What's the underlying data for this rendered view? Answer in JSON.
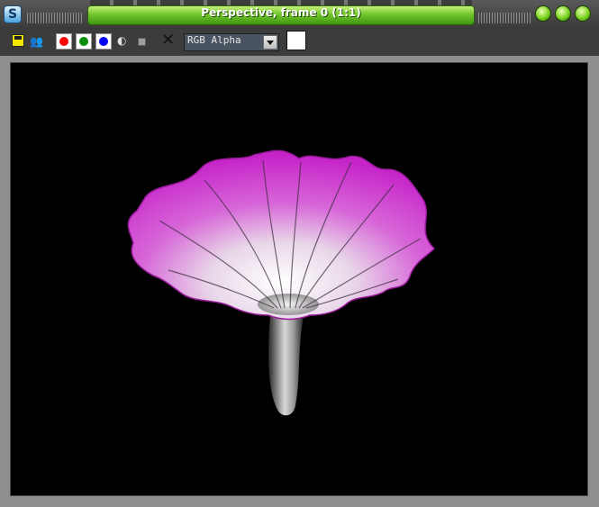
{
  "window": {
    "title": "Perspective, frame 0 (1:1)",
    "app_icon_glyph": "S",
    "accent_color": "#71c52a"
  },
  "toolbar": {
    "clone_glyph": "👥",
    "mono_glyph": "◐",
    "clear_glyph": "✕",
    "channel_select": {
      "value": "RGB Alpha"
    },
    "channel_colors": {
      "red": "#ff0000",
      "green": "#0a8f0a",
      "blue": "#0000ff"
    },
    "swatch_color": "#ffffff"
  },
  "viewport": {
    "background": "#000000",
    "petal_color": "#d534d6"
  }
}
